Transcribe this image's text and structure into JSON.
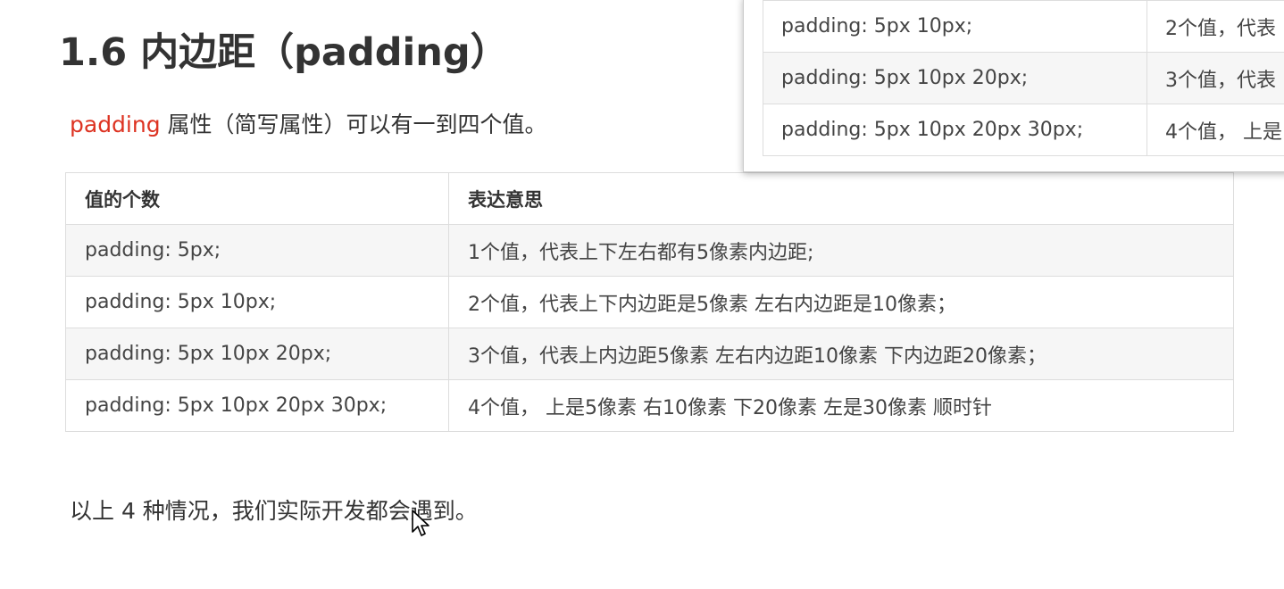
{
  "heading": "1.6 内边距（padding）",
  "intro": {
    "keyword": "padding",
    "rest": " 属性（简写属性）可以有一到四个值。"
  },
  "table": {
    "headers": [
      "值的个数",
      "表达意思"
    ],
    "rows": [
      [
        "padding: 5px;",
        "1个值，代表上下左右都有5像素内边距;"
      ],
      [
        "padding: 5px 10px;",
        "2个值，代表上下内边距是5像素   左右内边距是10像素；"
      ],
      [
        "padding: 5px 10px 20px;",
        "3个值，代表上内边距5像素   左右内边距10像素   下内边距20像素；"
      ],
      [
        "padding: 5px 10px 20px 30px;",
        "4个值，  上是5像素 右10像素 下20像素 左是30像素     顺时针"
      ]
    ]
  },
  "summary": "以上 4 种情况，我们实际开发都会遇到。",
  "popup_table": {
    "rows": [
      [
        "padding: 5px 10px;",
        "2个值，代表"
      ],
      [
        "padding: 5px 10px 20px;",
        "3个值，代表"
      ],
      [
        "padding: 5px 10px 20px 30px;",
        "4个值，  上是"
      ]
    ]
  }
}
